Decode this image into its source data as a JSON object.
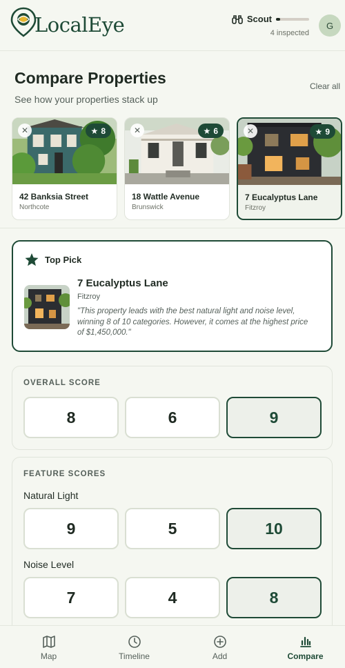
{
  "header": {
    "app_name": "LocalEye",
    "scout_label": "Scout",
    "scout_progress": 0.12,
    "inspected_text": "4 inspected",
    "avatar_initial": "G"
  },
  "page": {
    "title": "Compare Properties",
    "subtitle": "See how your properties stack up",
    "clear_label": "Clear all"
  },
  "properties": [
    {
      "name": "42 Banksia Street",
      "suburb": "Northcote",
      "score": "8",
      "selected": false
    },
    {
      "name": "18 Wattle Avenue",
      "suburb": "Brunswick",
      "score": "6",
      "selected": false
    },
    {
      "name": "7 Eucalyptus Lane",
      "suburb": "Fitzroy",
      "score": "9",
      "selected": true
    }
  ],
  "top_pick": {
    "label": "Top Pick",
    "name": "7 Eucalyptus Lane",
    "suburb": "Fitzroy",
    "quote": "\"This property leads with the best natural light and noise level, winning 8 of 10 categories. However, it comes at the highest price of $1,450,000.\""
  },
  "overall": {
    "title": "OVERALL SCORE",
    "scores": [
      "8",
      "6",
      "9"
    ]
  },
  "features": {
    "title": "FEATURE SCORES",
    "items": [
      {
        "label": "Natural Light",
        "scores": [
          "9",
          "5",
          "10"
        ]
      },
      {
        "label": "Noise Level",
        "scores": [
          "7",
          "4",
          "8"
        ]
      }
    ]
  },
  "tabs": [
    {
      "label": "Map",
      "icon": "map-icon"
    },
    {
      "label": "Timeline",
      "icon": "clock-icon"
    },
    {
      "label": "Add",
      "icon": "plus-circle-icon"
    },
    {
      "label": "Compare",
      "icon": "bar-chart-icon",
      "active": true
    }
  ],
  "colors": {
    "accent": "#1e4a36",
    "background": "#f5f7f1",
    "logo_pin": "#e6b52e"
  }
}
